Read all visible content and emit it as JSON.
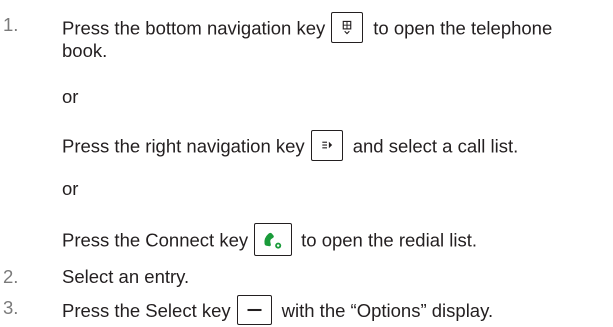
{
  "steps": [
    {
      "number": "1.",
      "line1_before": "Press the bottom navigation key",
      "line1_after": "to open the telephone",
      "line2": "book.",
      "key_icon": "phonebook-icon"
    },
    {
      "or": "or"
    },
    {
      "before": "Press the right navigation key",
      "after": "and select a call list.",
      "key_icon": "call-list-icon"
    },
    {
      "or": "or"
    },
    {
      "before": "Press the Connect key",
      "after": "to open the redial list.",
      "key_icon": "connect-handset-icon",
      "accent_color": "#1a9b3a"
    },
    {
      "number": "2.",
      "text": "Select an entry."
    },
    {
      "number": "3.",
      "before": "Press the Select key",
      "after": "with the “Options” display.",
      "key_icon": "select-dash-icon"
    }
  ]
}
